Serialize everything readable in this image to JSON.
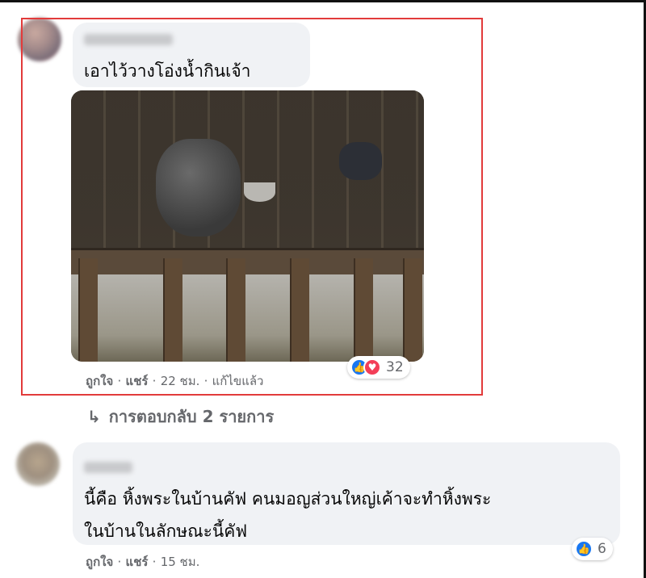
{
  "comment1": {
    "text": "เอาไว้วางโอ่งน้ำกินเจ้า",
    "actions": {
      "like": "ถูกใจ",
      "share": "แชร์",
      "time": "22 ชม.",
      "edited": "แก้ไขแล้ว"
    },
    "reactions_count": "32",
    "sep": "·"
  },
  "replies": {
    "label": "การตอบกลับ 2 รายการ",
    "arrow": "↳"
  },
  "comment2": {
    "line1": "นี้คือ หิ้งพระในบ้านคัฟ คนมอญส่วนใหญ่เค้าจะทำหิ้งพระ",
    "line2": "ในบ้านในลักษณะนี้คัฟ",
    "actions": {
      "like": "ถูกใจ",
      "share": "แชร์",
      "time": "15 ชม."
    },
    "reactions_count": "6",
    "sep": "·"
  },
  "icons": {
    "like": "👍",
    "love": "♥"
  },
  "colors": {
    "highlight": "#e23b3b",
    "like_blue": "#1877f2",
    "love_red": "#f33e58",
    "bubble": "#f0f2f5",
    "meta": "#65676b"
  }
}
